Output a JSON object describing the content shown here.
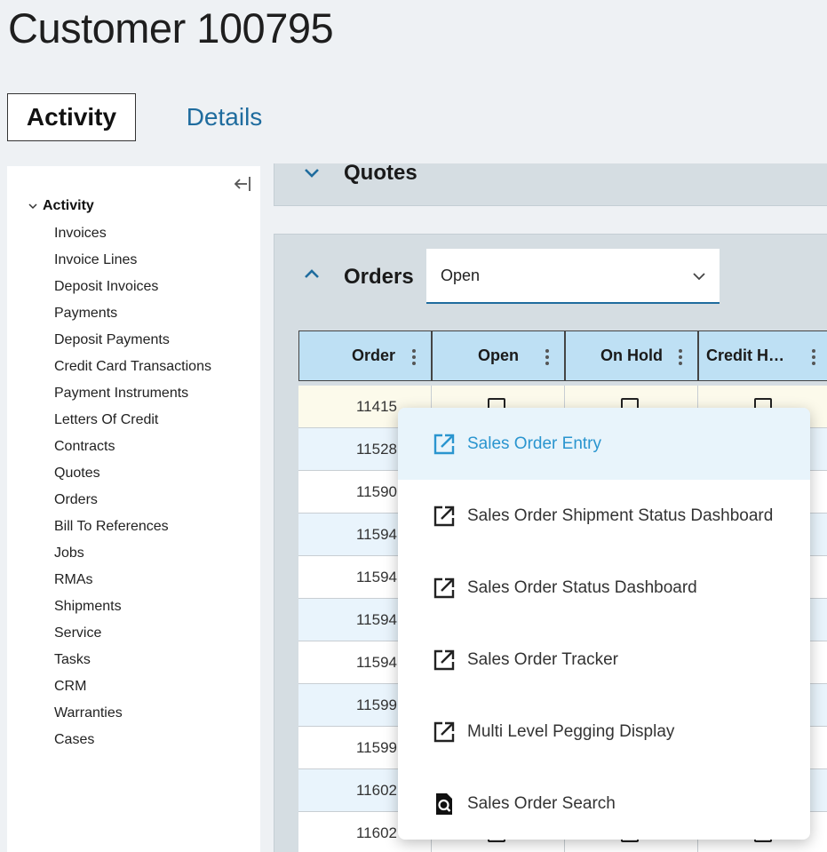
{
  "page": {
    "title": "Customer 100795"
  },
  "tabs": [
    {
      "label": "Activity",
      "selected": true
    },
    {
      "label": "Details",
      "selected": false
    }
  ],
  "sidebar": {
    "collapse_icon": "collapse-left-icon",
    "root": {
      "label": "Activity",
      "expanded": true
    },
    "items": [
      {
        "label": "Invoices"
      },
      {
        "label": "Invoice Lines"
      },
      {
        "label": "Deposit Invoices"
      },
      {
        "label": "Payments"
      },
      {
        "label": "Deposit Payments"
      },
      {
        "label": "Credit Card Transactions"
      },
      {
        "label": "Payment Instruments"
      },
      {
        "label": "Letters Of Credit"
      },
      {
        "label": "Contracts"
      },
      {
        "label": "Quotes"
      },
      {
        "label": "Orders"
      },
      {
        "label": "Bill To References"
      },
      {
        "label": "Jobs"
      },
      {
        "label": "RMAs"
      },
      {
        "label": "Shipments"
      },
      {
        "label": "Service"
      },
      {
        "label": "Tasks"
      },
      {
        "label": "CRM"
      },
      {
        "label": "Warranties"
      },
      {
        "label": "Cases"
      }
    ]
  },
  "quotes_panel": {
    "title": "Quotes",
    "expanded": false
  },
  "orders_panel": {
    "title": "Orders",
    "expanded": true,
    "filter": {
      "value": "Open"
    },
    "columns": [
      {
        "label": "Order"
      },
      {
        "label": "Open"
      },
      {
        "label": "On Hold"
      },
      {
        "label": "Credit H…"
      }
    ],
    "rows": [
      {
        "order": "11415",
        "open": true,
        "on_hold": false,
        "credit_hold": false
      },
      {
        "order": "11528",
        "open": true,
        "on_hold": false,
        "credit_hold": false
      },
      {
        "order": "11590",
        "open": true,
        "on_hold": false,
        "credit_hold": false
      },
      {
        "order": "11594",
        "open": true,
        "on_hold": false,
        "credit_hold": false
      },
      {
        "order": "11594",
        "open": true,
        "on_hold": false,
        "credit_hold": false
      },
      {
        "order": "11594",
        "open": true,
        "on_hold": false,
        "credit_hold": false
      },
      {
        "order": "11594",
        "open": true,
        "on_hold": false,
        "credit_hold": false
      },
      {
        "order": "11599",
        "open": true,
        "on_hold": false,
        "credit_hold": false
      },
      {
        "order": "11599",
        "open": true,
        "on_hold": false,
        "credit_hold": false
      },
      {
        "order": "11602",
        "open": true,
        "on_hold": false,
        "credit_hold": false
      },
      {
        "order": "11602",
        "open": true,
        "on_hold": false,
        "credit_hold": false
      }
    ]
  },
  "context_menu": {
    "items": [
      {
        "label": "Sales Order Entry",
        "icon": "open-external-icon",
        "active": true
      },
      {
        "label": "Sales Order Shipment Status Dashboard",
        "icon": "open-external-icon",
        "active": false
      },
      {
        "label": "Sales Order Status Dashboard",
        "icon": "open-external-icon",
        "active": false
      },
      {
        "label": "Sales Order Tracker",
        "icon": "open-external-icon",
        "active": false
      },
      {
        "label": "Multi Level Pegging Display",
        "icon": "open-external-icon",
        "active": false
      },
      {
        "label": "Sales Order Search",
        "icon": "search-document-icon",
        "active": false
      }
    ]
  },
  "colors": {
    "accent": "#1f6c9e",
    "menu_active_text": "#2a95cf",
    "header_bg": "#bee0f4",
    "panel_bg": "#d5dde2"
  }
}
